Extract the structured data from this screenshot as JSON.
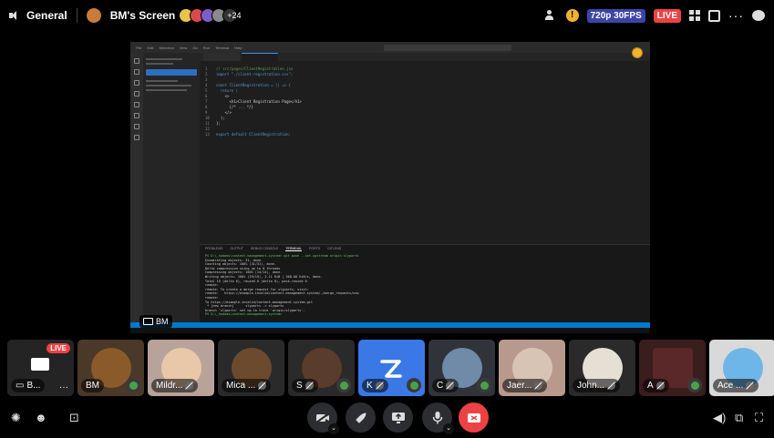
{
  "topbar": {
    "channel": "General",
    "screen_owner": "BM's Screen",
    "viewer_extra": "+24",
    "quality": "720p 30FPS",
    "live": "LIVE"
  },
  "stream": {
    "sharer_label": "BM",
    "menu": [
      "File",
      "Edit",
      "Selection",
      "View",
      "Go",
      "Run",
      "Terminal",
      "Help"
    ],
    "code_lines": [
      {
        "n": "1",
        "text": "// src/pages/ClientRegistration.jsx"
      },
      {
        "n": "2",
        "text": "import \"./client-registration.css\";"
      },
      {
        "n": "3",
        "text": ""
      },
      {
        "n": "4",
        "text": "const ClientRegistration = () => {"
      },
      {
        "n": "5",
        "text": "  return ("
      },
      {
        "n": "6",
        "text": "    <>"
      },
      {
        "n": "7",
        "text": "      <h1>Client Registration Page</h1>"
      },
      {
        "n": "8",
        "text": "      {/* ... */}"
      },
      {
        "n": "9",
        "text": "    </>"
      },
      {
        "n": "10",
        "text": "  );"
      },
      {
        "n": "11",
        "text": "};"
      },
      {
        "n": "12",
        "text": ""
      },
      {
        "n": "13",
        "text": "export default ClientRegistration;"
      }
    ],
    "panel_tabs": [
      "PROBLEMS",
      "OUTPUT",
      "DEBUG CONSOLE",
      "TERMINAL",
      "PORTS",
      "GITLENS"
    ],
    "terminal_lines": [
      "PS D:\\_hodoms\\content-management-system> git push --set-upstream origin slyparts",
      "Enumerating objects: 31, done.",
      "Counting objects: 100% (31/31), done.",
      "Delta compression using up to 8 threads",
      "Compressing objects: 100% (14/14), done.",
      "Writing objects: 100% (19/19), 2.11 KiB | 360.00 KiB/s, done.",
      "Total 19 (delta 6), reused 0 (delta 0), pack-reused 0",
      "remote:",
      "remote: To create a merge request for slyparts, visit:",
      "remote:   https://example.invalid/content-management-system/-/merge_requests/new",
      "remote:",
      "To https://example.invalid/content-management-system.git",
      " * [new branch]      slyparts -> slyparts",
      "branch 'slyparts' set up to track 'origin/slyparts'.",
      "PS D:\\_hodoms\\content-management-system> "
    ]
  },
  "participants": [
    {
      "id": "live",
      "name": "B...",
      "live": "LIVE"
    },
    {
      "id": "bm",
      "name": "BM"
    },
    {
      "id": "mildr",
      "name": "Mildr..."
    },
    {
      "id": "mica",
      "name": "Mica ..."
    },
    {
      "id": "s",
      "name": "S"
    },
    {
      "id": "k",
      "name": "K"
    },
    {
      "id": "c",
      "name": "C"
    },
    {
      "id": "jaer",
      "name": "Jaer..."
    },
    {
      "id": "john",
      "name": "John..."
    },
    {
      "id": "a",
      "name": "A"
    },
    {
      "id": "ace",
      "name": "Ace ..."
    }
  ],
  "colors": {
    "live_red": "#ed4245",
    "quality_blue": "#3c45a5",
    "active_tile_blue": "#3a78e6",
    "vscode_blue": "#007acc"
  },
  "icons": {
    "controls": [
      "camera-off-icon",
      "activity-rocket-icon",
      "share-screen-icon",
      "microphone-icon",
      "disconnect-icon"
    ]
  }
}
